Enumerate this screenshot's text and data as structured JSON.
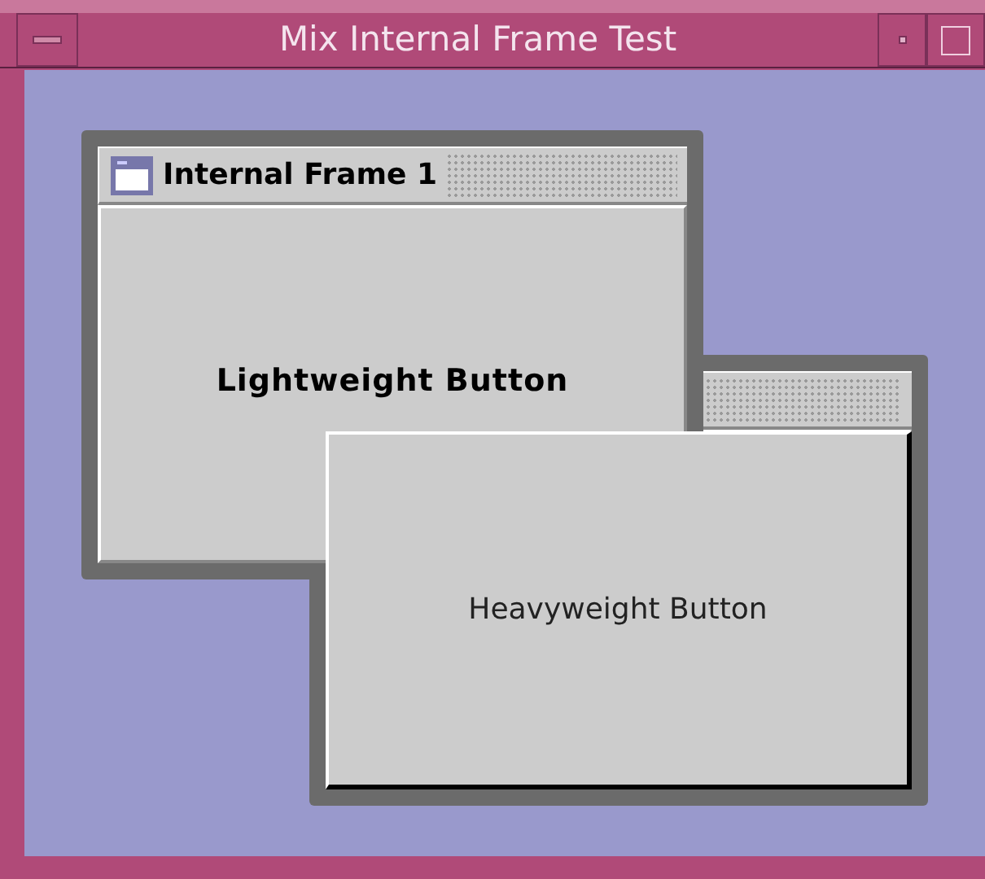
{
  "window": {
    "title": "Mix Internal Frame Test"
  },
  "internal_frames": [
    {
      "title": "Internal Frame 1",
      "content": {
        "kind": "lightweight",
        "label": "Lightweight Button"
      }
    },
    {
      "content": {
        "kind": "heavyweight",
        "label": "Heavyweight Button"
      }
    }
  ]
}
